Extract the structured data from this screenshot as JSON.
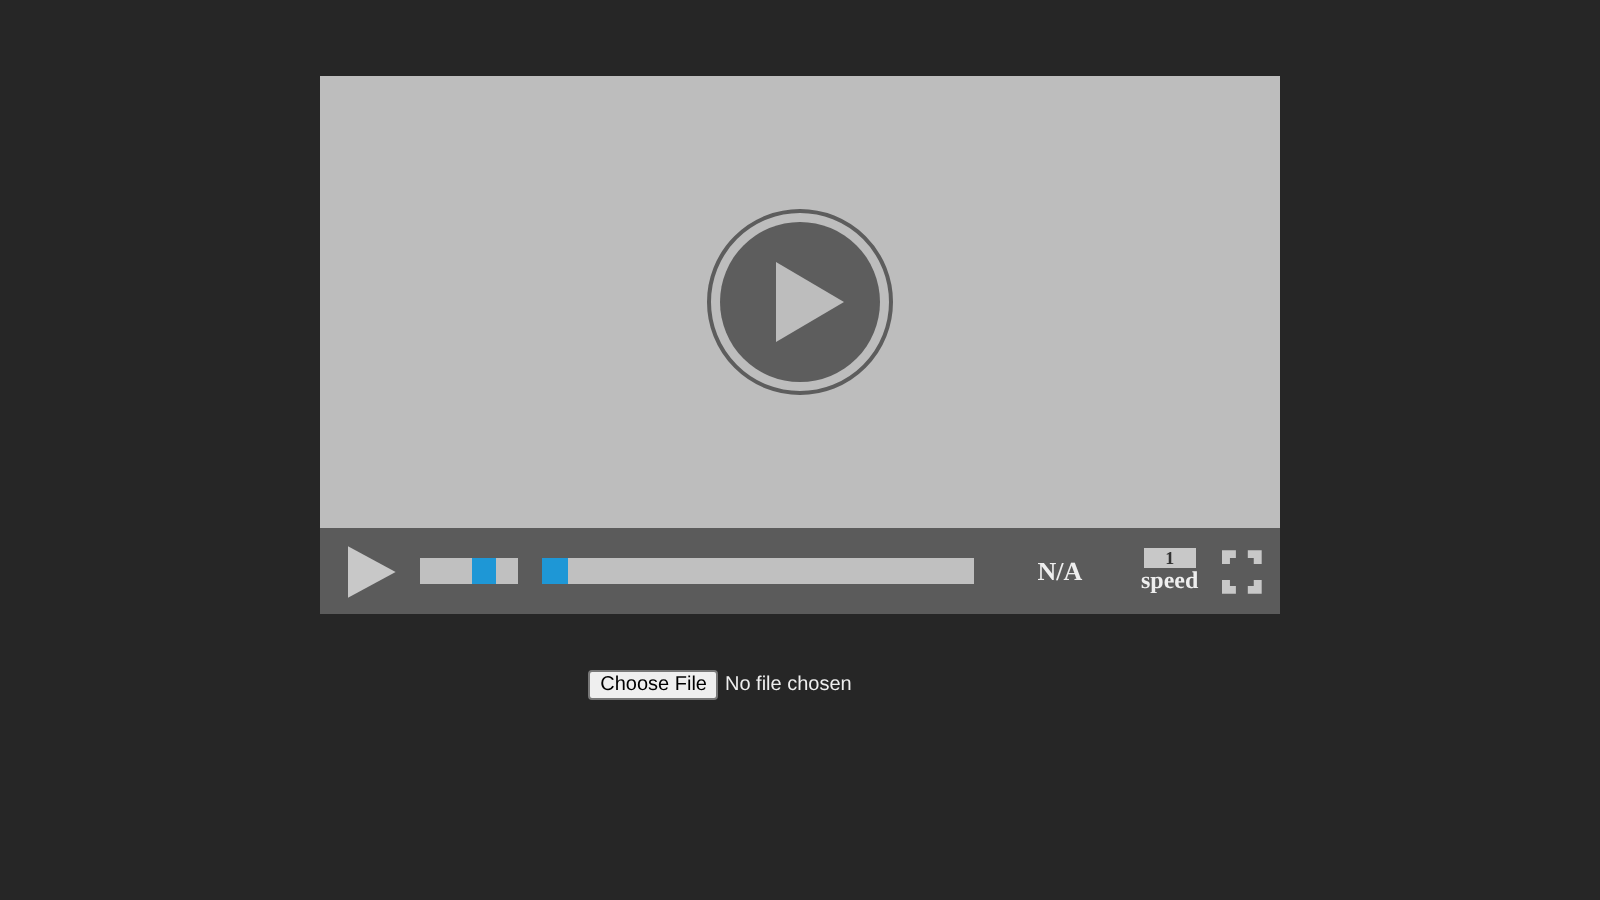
{
  "player": {
    "volume": {
      "level": 0.68
    },
    "progress": {
      "level": 0
    },
    "time": "N/A",
    "speed": {
      "value": "1",
      "label": "speed"
    }
  },
  "file_input": {
    "button": "Choose File",
    "status": "No file chosen"
  }
}
